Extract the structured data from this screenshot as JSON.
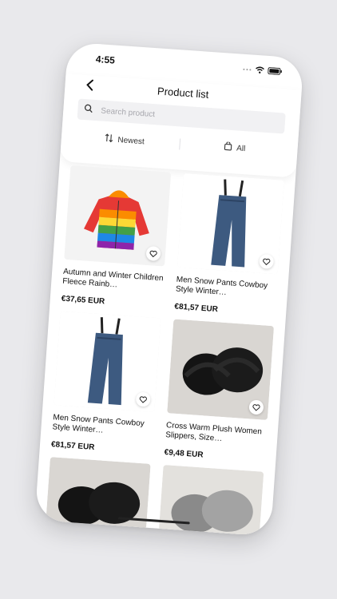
{
  "status": {
    "time": "4:55"
  },
  "header": {
    "title": "Product list",
    "search_placeholder": "Search product",
    "sort_label": "Newest",
    "filter_label": "All"
  },
  "products": [
    {
      "name": "Autumn and Winter Children Fleece Rainb…",
      "price": "€37,65 EUR",
      "image": "rainbow-jacket"
    },
    {
      "name": "Men Snow Pants Cowboy Style Winter…",
      "price": "€81,57 EUR",
      "image": "denim-overalls"
    },
    {
      "name": "Men Snow Pants Cowboy Style Winter…",
      "price": "€81,57 EUR",
      "image": "denim-overalls"
    },
    {
      "name": "Cross Warm Plush Women Slippers, Size…",
      "price": "€9,48 EUR",
      "image": "black-slippers"
    },
    {
      "image": "black-slippers"
    },
    {
      "image": "grey-slippers"
    }
  ]
}
